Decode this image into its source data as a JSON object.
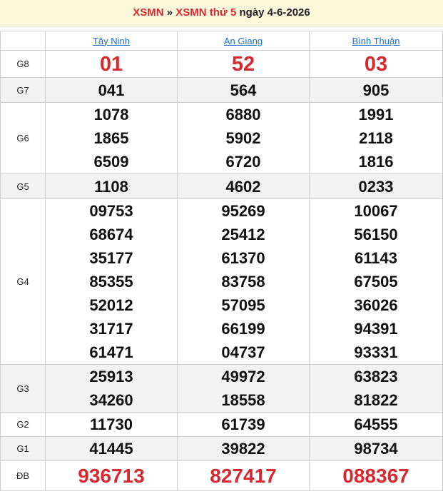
{
  "header": {
    "link1": "XSMN",
    "separator": "»",
    "link2": "XSMN thứ 5",
    "date_text": "ngày 4-6-2026"
  },
  "provinces": [
    "Tây Ninh",
    "An Giang",
    "Bình Thuận"
  ],
  "prizes": [
    {
      "label": "G8",
      "values": [
        [
          "01"
        ],
        [
          "52"
        ],
        [
          "03"
        ]
      ]
    },
    {
      "label": "G7",
      "values": [
        [
          "041"
        ],
        [
          "564"
        ],
        [
          "905"
        ]
      ]
    },
    {
      "label": "G6",
      "values": [
        [
          "1078",
          "1865",
          "6509"
        ],
        [
          "6880",
          "5902",
          "6720"
        ],
        [
          "1991",
          "2118",
          "1816"
        ]
      ]
    },
    {
      "label": "G5",
      "values": [
        [
          "1108"
        ],
        [
          "4602"
        ],
        [
          "0233"
        ]
      ]
    },
    {
      "label": "G4",
      "values": [
        [
          "09753",
          "68674",
          "35177",
          "85355",
          "52012",
          "31717",
          "61471"
        ],
        [
          "95269",
          "25412",
          "61370",
          "83758",
          "57095",
          "66199",
          "04737"
        ],
        [
          "10067",
          "56150",
          "61143",
          "67505",
          "36026",
          "94391",
          "93331"
        ]
      ]
    },
    {
      "label": "G3",
      "values": [
        [
          "25913",
          "34260"
        ],
        [
          "49972",
          "18558"
        ],
        [
          "63823",
          "81822"
        ]
      ]
    },
    {
      "label": "G2",
      "values": [
        [
          "11730"
        ],
        [
          "61739"
        ],
        [
          "64555"
        ]
      ]
    },
    {
      "label": "G1",
      "values": [
        [
          "41445"
        ],
        [
          "39822"
        ],
        [
          "98734"
        ]
      ]
    },
    {
      "label": "ĐB",
      "values": [
        [
          "936713"
        ],
        [
          "827417"
        ],
        [
          "088367"
        ]
      ]
    }
  ],
  "colors": {
    "accent": "#d7282f",
    "link": "#1a6fc9",
    "header_bg": "#fcf8dc",
    "alt_row": "#f2f2f2"
  }
}
